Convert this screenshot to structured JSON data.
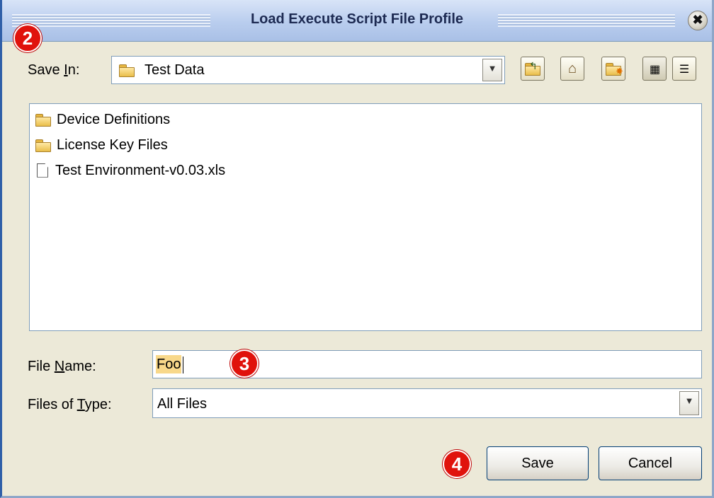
{
  "window": {
    "title": "Load Execute Script File Profile",
    "close_glyph": "✖"
  },
  "callouts": [
    "2",
    "3",
    "4"
  ],
  "save_in": {
    "label_pre": "Save ",
    "label_mnemonic": "I",
    "label_post": "n:",
    "value": "Test Data",
    "icon": "folder-icon"
  },
  "toolbar": {
    "up_folder": "folder-up-icon",
    "home": "home-icon",
    "new_folder": "new-folder-icon",
    "list_view": "list-view-icon",
    "details_view": "details-view-icon"
  },
  "files": [
    {
      "name": "Device Definitions",
      "icon": "folder-icon"
    },
    {
      "name": "License Key Files",
      "icon": "folder-icon"
    },
    {
      "name": "Test Environment-v0.03.xls",
      "icon": "file-icon"
    }
  ],
  "file_name": {
    "label_pre": "File ",
    "label_mnemonic": "N",
    "label_post": "ame:",
    "value": "Foo"
  },
  "files_of_type": {
    "label_pre": "Files of ",
    "label_mnemonic": "T",
    "label_post": "ype:",
    "value": "All Files"
  },
  "buttons": {
    "save": "Save",
    "cancel": "Cancel"
  },
  "colors": {
    "callout": "#e0120c",
    "dialog_bg": "#ece9d8",
    "title_bar": "#b9cdee"
  }
}
